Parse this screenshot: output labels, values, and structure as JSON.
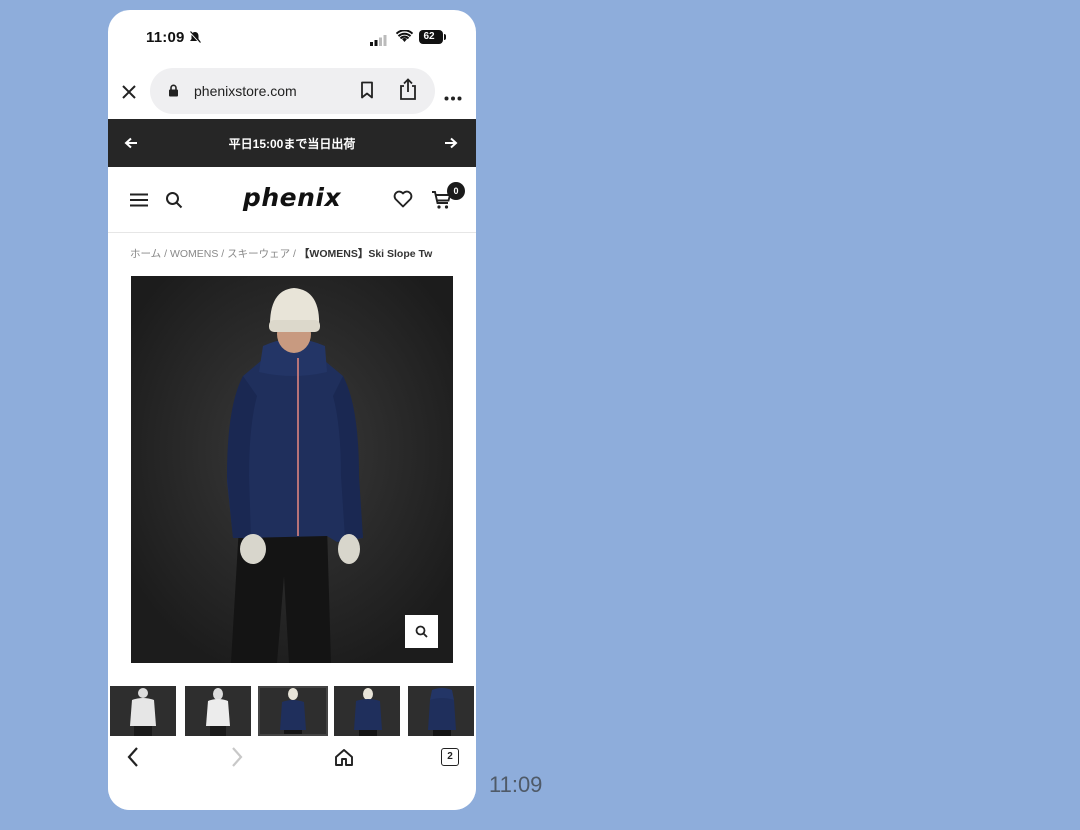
{
  "status_bar": {
    "time": "11:09",
    "battery": "62"
  },
  "browser": {
    "url": "phenixstore.com",
    "tab_count": "2"
  },
  "announcement": {
    "text": "平日15:00まで当日出荷"
  },
  "header": {
    "logo": "phenix",
    "cart_count": "0"
  },
  "breadcrumb": {
    "items": [
      "ホーム",
      "WOMENS",
      "スキーウェア"
    ],
    "separator": " / ",
    "current": "【WOMENS】Ski Slope Tw"
  },
  "product": {
    "jacket_color": "#1f2f5c",
    "background_color": "#262626",
    "thumbnails": [
      {
        "variant": "white-back"
      },
      {
        "variant": "white-front"
      },
      {
        "variant": "navy-front",
        "selected": true
      },
      {
        "variant": "navy-front-hooded"
      },
      {
        "variant": "navy-back"
      }
    ]
  },
  "chat": {
    "time": "11:09"
  },
  "colors": {
    "page_background": "#8eaddb",
    "announcement_bg": "#262626"
  }
}
